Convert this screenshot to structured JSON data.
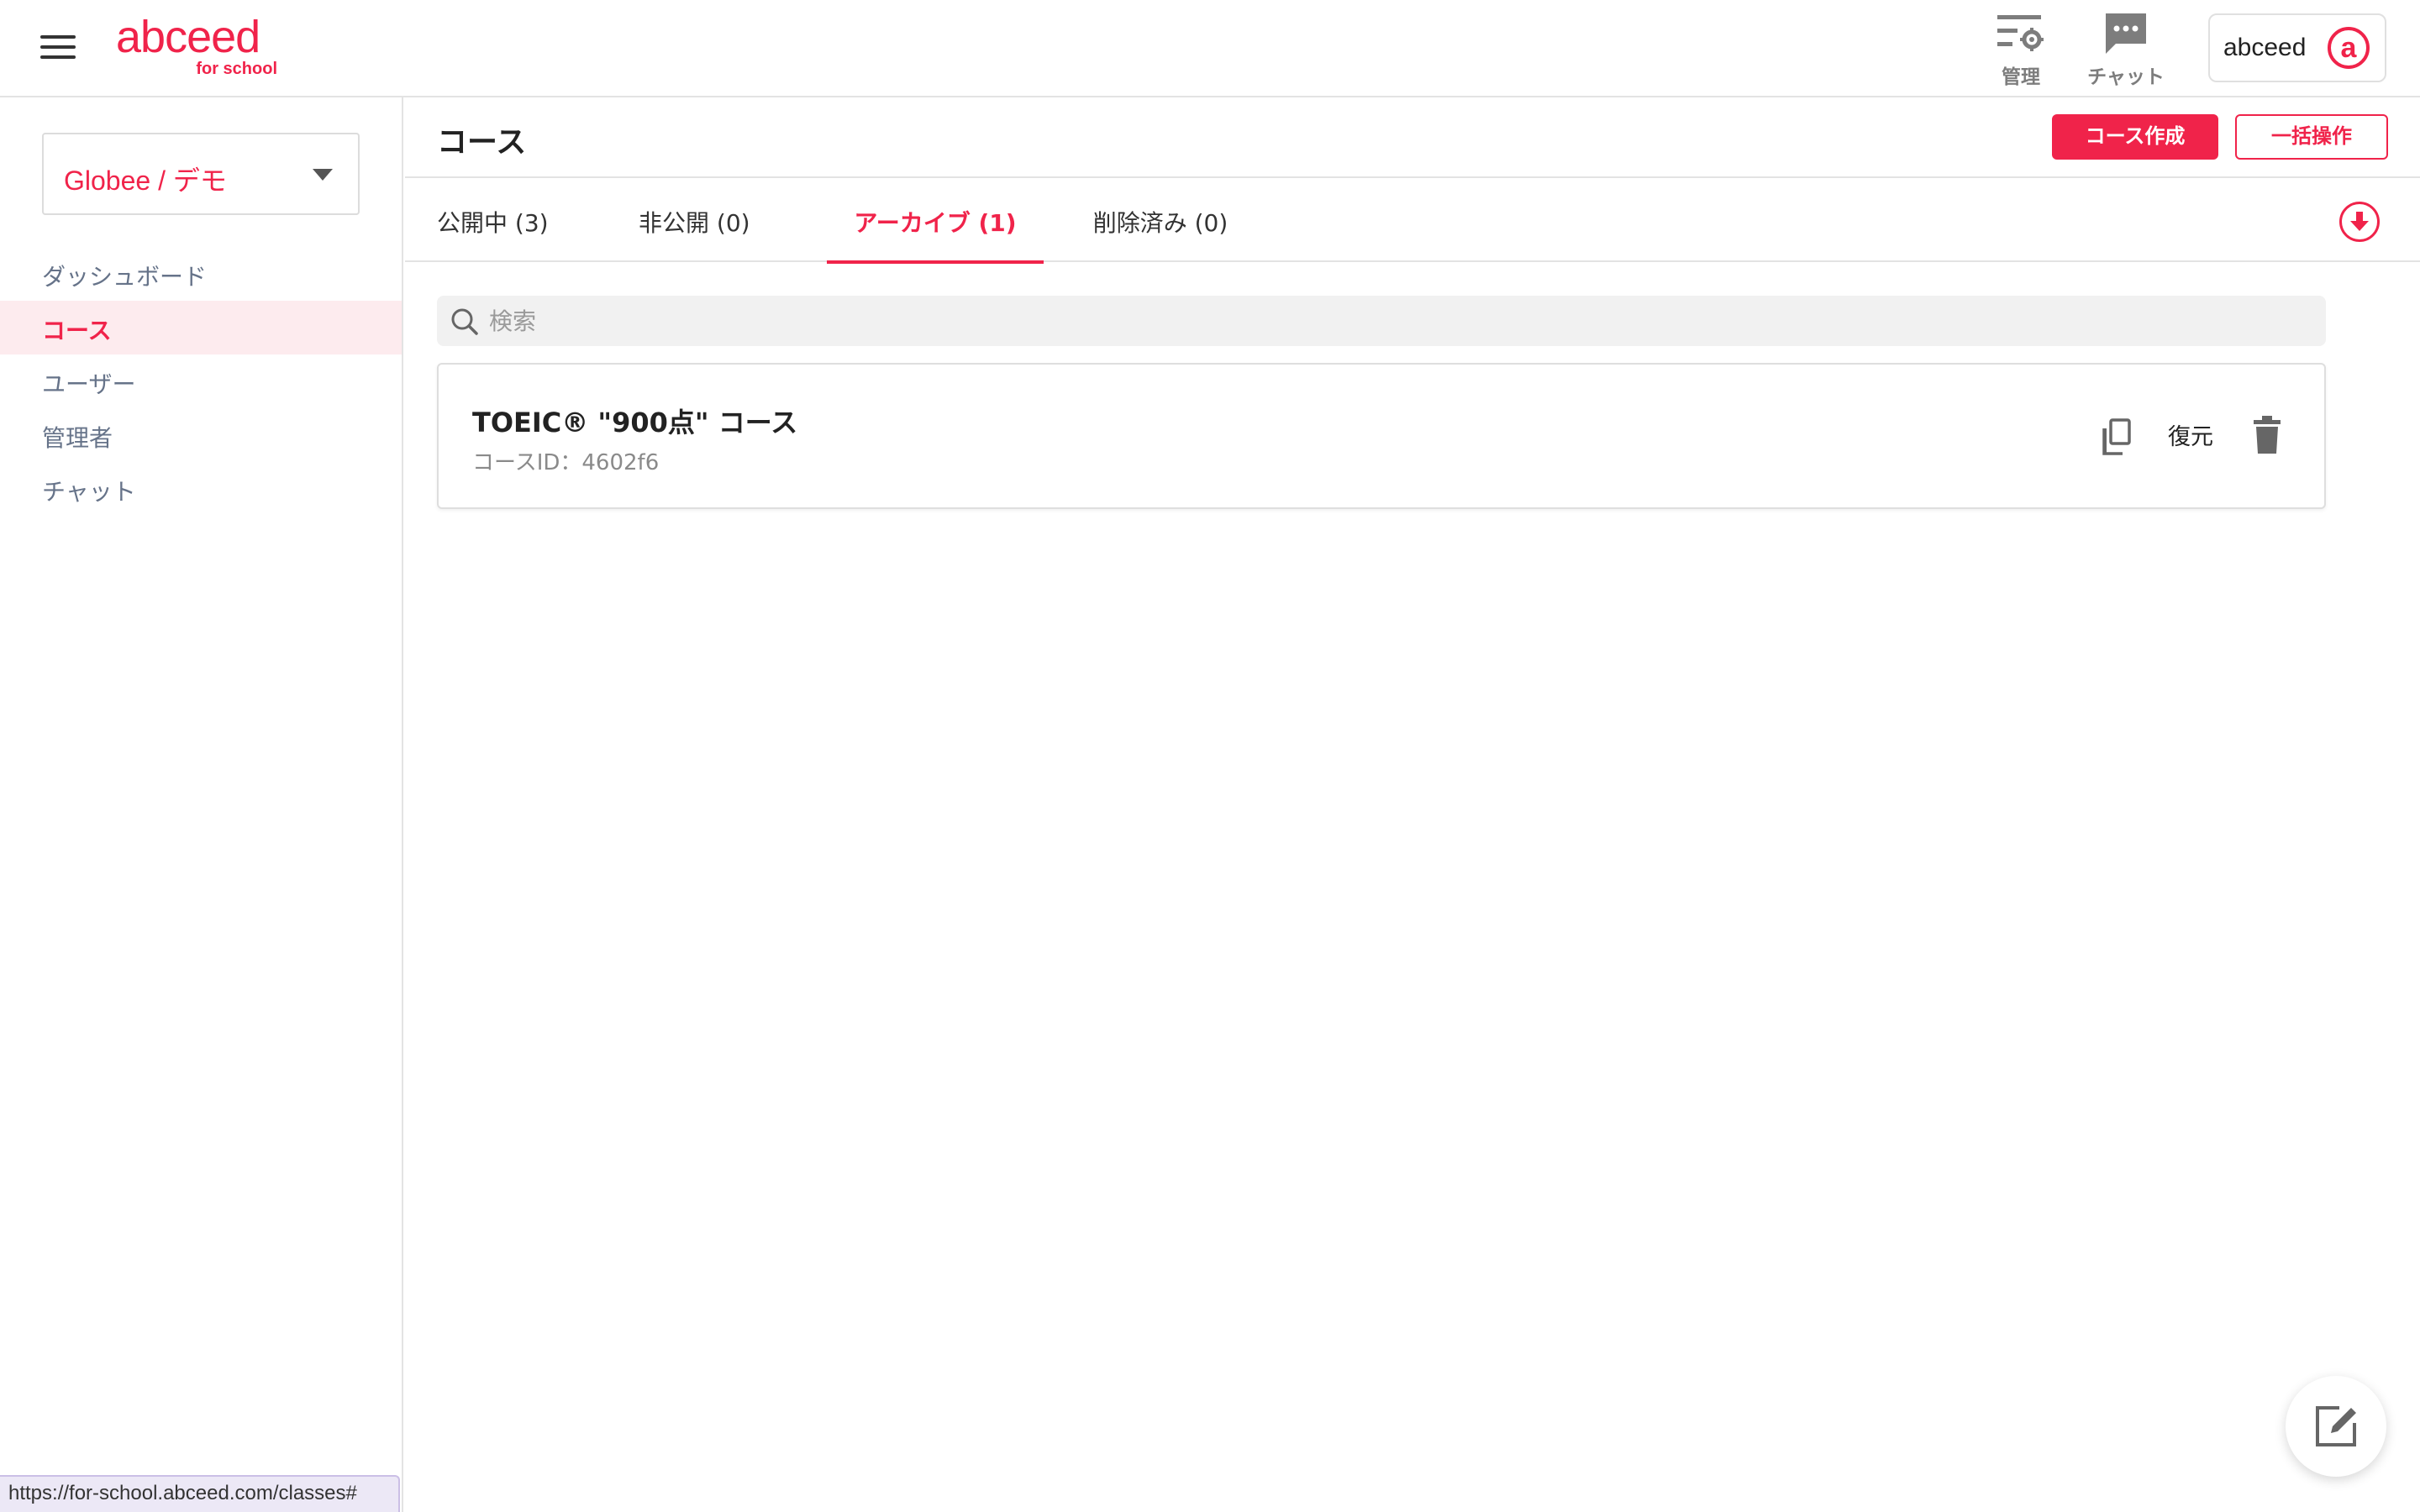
{
  "header": {
    "logo_text": "abceed",
    "logo_sub": "for school",
    "manage_label": "管理",
    "chat_label": "チャット",
    "account_name": "abceed",
    "account_avatar_glyph": "a"
  },
  "sidebar": {
    "org_selector": "Globee / デモ",
    "items": [
      {
        "label": "ダッシュボード",
        "active": false
      },
      {
        "label": "コース",
        "active": true
      },
      {
        "label": "ユーザー",
        "active": false
      },
      {
        "label": "管理者",
        "active": false
      },
      {
        "label": "チャット",
        "active": false
      }
    ]
  },
  "page": {
    "title": "コース",
    "create_button": "コース作成",
    "bulk_button": "一括操作"
  },
  "tabs": [
    {
      "label": "公開中 (3)",
      "active": false
    },
    {
      "label": "非公開 (0)",
      "active": false
    },
    {
      "label": "アーカイブ (1)",
      "active": true
    },
    {
      "label": "削除済み (0)",
      "active": false
    }
  ],
  "search": {
    "placeholder": "検索",
    "value": ""
  },
  "courses": [
    {
      "name": "TOEIC® \"900点\" コース",
      "id_label": "コースID：4602f6",
      "restore_label": "復元"
    }
  ],
  "status_bar": {
    "url": "https://for-school.abceed.com/classes#"
  },
  "colors": {
    "brand": "#f0234a",
    "active_nav_bg": "#fdebee",
    "nav_text": "#667389"
  },
  "icons": {
    "menu": "hamburger-icon",
    "manage": "settings-list-icon",
    "chat": "chat-bubble-icon",
    "download": "download-circle-icon",
    "search": "search-icon",
    "copy": "copy-icon",
    "delete": "trash-icon",
    "compose": "edit-icon"
  }
}
